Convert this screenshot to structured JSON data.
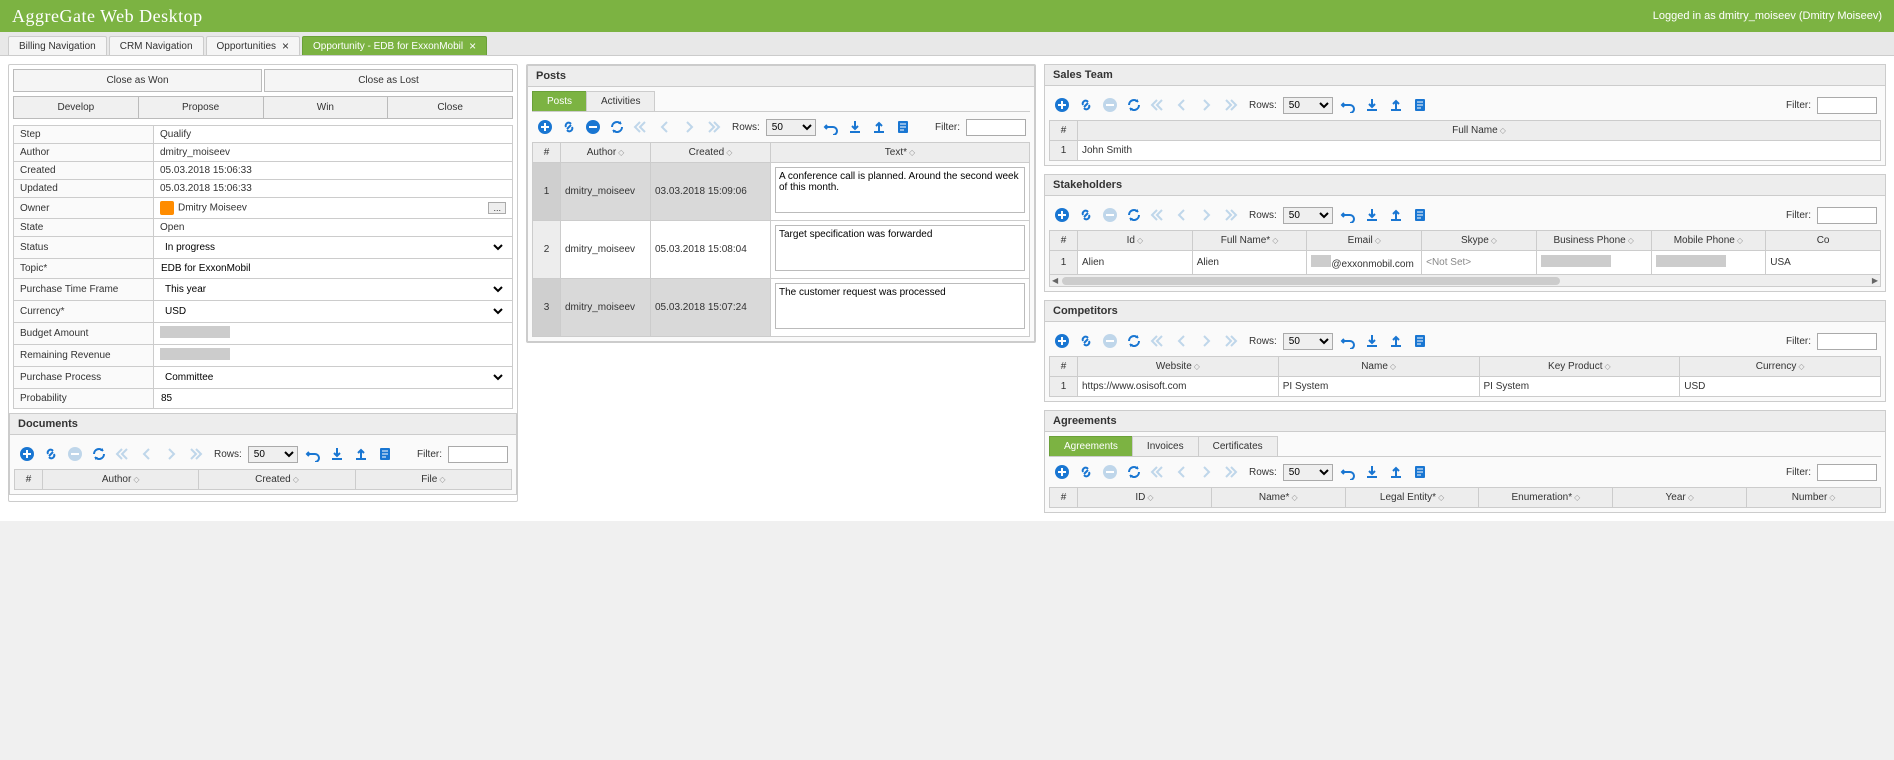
{
  "header": {
    "logo": "AggreGate Web Desktop",
    "user": "Logged in as dmitry_moiseev (Dmitry Moiseev)"
  },
  "tabs": [
    {
      "label": "Billing Navigation",
      "closable": false,
      "active": false
    },
    {
      "label": "CRM Navigation",
      "closable": false,
      "active": false
    },
    {
      "label": "Opportunities",
      "closable": true,
      "active": false
    },
    {
      "label": "Opportunity - EDB for ExxonMobil",
      "closable": true,
      "active": true
    }
  ],
  "close_actions": {
    "won": "Close as Won",
    "lost": "Close as Lost"
  },
  "stages": [
    "Develop",
    "Propose",
    "Win",
    "Close"
  ],
  "info": {
    "Step": "Qualify",
    "Author": "dmitry_moiseev",
    "Created": "05.03.2018 15:06:33",
    "Updated": "05.03.2018 15:06:33",
    "Owner": "Dmitry Moiseev",
    "State": "Open",
    "Status": "In progress",
    "Topic*": "EDB for ExxonMobil",
    "Purchase Time Frame": "This year",
    "Currency*": "USD",
    "Budget Amount": "",
    "Remaining Revenue": "",
    "Purchase Process": "Committee",
    "Probability": "85"
  },
  "documents": {
    "title": "Documents",
    "rows_label": "Rows:",
    "rows_value": "50",
    "filter_label": "Filter:",
    "cols": [
      "#",
      "Author",
      "Created",
      "File"
    ]
  },
  "posts": {
    "title": "Posts",
    "tabs": [
      "Posts",
      "Activities"
    ],
    "rows_label": "Rows:",
    "rows_value": "50",
    "filter_label": "Filter:",
    "cols": [
      "#",
      "Author",
      "Created",
      "Text*"
    ],
    "rows": [
      {
        "n": "1",
        "author": "dmitry_moiseev",
        "created": "03.03.2018 15:09:06",
        "text": "A conference call is planned. Around the second week of this month."
      },
      {
        "n": "2",
        "author": "dmitry_moiseev",
        "created": "05.03.2018 15:08:04",
        "text": "Target specification was forwarded"
      },
      {
        "n": "3",
        "author": "dmitry_moiseev",
        "created": "05.03.2018 15:07:24",
        "text": "The customer request was processed"
      }
    ]
  },
  "sales_team": {
    "title": "Sales Team",
    "rows_label": "Rows:",
    "rows_value": "50",
    "filter_label": "Filter:",
    "cols": [
      "#",
      "Full Name"
    ],
    "rows": [
      {
        "n": "1",
        "name": "John Smith"
      }
    ]
  },
  "stakeholders": {
    "title": "Stakeholders",
    "rows_label": "Rows:",
    "rows_value": "50",
    "filter_label": "Filter:",
    "cols": [
      "#",
      "Id",
      "Full Name*",
      "Email",
      "Skype",
      "Business Phone",
      "Mobile Phone",
      "Co"
    ],
    "rows": [
      {
        "n": "1",
        "id": "Alien",
        "name": "Alien",
        "email": "@exxonmobil.com",
        "skype": "<Not Set>",
        "bphone": "",
        "mphone": "",
        "country": "USA"
      }
    ]
  },
  "competitors": {
    "title": "Competitors",
    "rows_label": "Rows:",
    "rows_value": "50",
    "filter_label": "Filter:",
    "cols": [
      "#",
      "Website",
      "Name",
      "Key Product",
      "Currency"
    ],
    "rows": [
      {
        "n": "1",
        "website": "https://www.osisoft.com",
        "name": "PI System",
        "product": "PI System",
        "currency": "USD"
      }
    ]
  },
  "agreements": {
    "title": "Agreements",
    "tabs": [
      "Agreements",
      "Invoices",
      "Certificates"
    ],
    "rows_label": "Rows:",
    "rows_value": "50",
    "filter_label": "Filter:",
    "cols": [
      "#",
      "ID",
      "Name*",
      "Legal Entity*",
      "Enumeration*",
      "Year",
      "Number"
    ]
  }
}
